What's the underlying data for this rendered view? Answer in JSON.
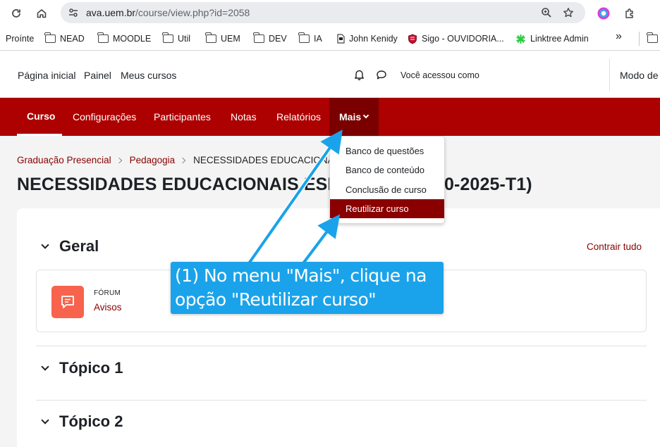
{
  "browser": {
    "url_host": "ava.uem.br",
    "url_path": "/course/view.php?id=2058",
    "bookmarks": [
      "Proínte",
      "NEAD",
      "MOODLE",
      "Util",
      "UEM",
      "DEV",
      "IA",
      "John Kenidy",
      "Sigo - OUVIDORIA...",
      "Linktree Admin"
    ],
    "more_symbol": "»"
  },
  "header": {
    "primary_nav": [
      "Página inicial",
      "Painel",
      "Meus cursos"
    ],
    "logged_in_as": "Você acessou como",
    "edit_mode": "Modo de"
  },
  "course_nav": {
    "items": [
      "Curso",
      "Configurações",
      "Participantes",
      "Notas",
      "Relatórios"
    ],
    "more_label": "Mais",
    "active_index": 0
  },
  "dropdown": {
    "items": [
      "Banco de questões",
      "Banco de conteúdo",
      "Conclusão de curso",
      "Reutilizar curso"
    ],
    "highlighted_index": 3
  },
  "breadcrumb": {
    "items": [
      "Graduação Presencial",
      "Pedagogia"
    ],
    "current": "NECESSIDADES EDUCACIONAIS E"
  },
  "page": {
    "title_left": "NECESSIDADES EDUCACIONAIS ESP",
    "title_right": "70-2025-T1)",
    "collapse_all": "Contrair tudo"
  },
  "sections": [
    {
      "title": "Geral"
    },
    {
      "title": "Tópico 1"
    },
    {
      "title": "Tópico 2"
    }
  ],
  "activity": {
    "type": "FÓRUM",
    "name": "Avisos"
  },
  "annotation": {
    "text_line1": "(1) No menu \"Mais\", clique na",
    "text_line2": "opção \"Reutilizar curso\"",
    "color": "#1aa3ea"
  },
  "colors": {
    "brand": "#ad0000",
    "link": "#8a0000",
    "forum_icon": "#f7634d"
  }
}
